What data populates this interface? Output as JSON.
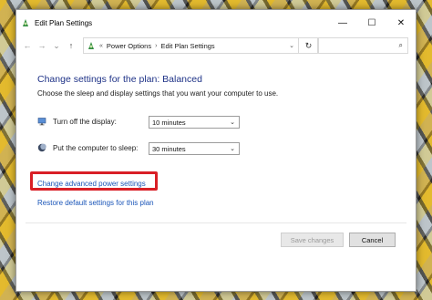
{
  "window": {
    "title": "Edit Plan Settings",
    "minimize_glyph": "—",
    "maximize_glyph": "☐",
    "close_glyph": "✕"
  },
  "nav": {
    "back_glyph": "←",
    "forward_glyph": "→",
    "dropdown_glyph": "⌄",
    "up_glyph": "↑",
    "overflow_glyph": "«",
    "breadcrumb": [
      "Power Options",
      "Edit Plan Settings"
    ],
    "separator_glyph": "›",
    "refresh_glyph": "↻",
    "search_placeholder": "",
    "search_glyph": "⌕"
  },
  "main": {
    "heading": "Change settings for the plan: Balanced",
    "subheading": "Choose the sleep and display settings that you want your computer to use.",
    "settings": [
      {
        "icon": "display-icon",
        "label": "Turn off the display:",
        "value": "10 minutes"
      },
      {
        "icon": "moon-icon",
        "label": "Put the computer to sleep:",
        "value": "30 minutes"
      }
    ],
    "select_chevron": "⌄",
    "advanced_link": "Change advanced power settings",
    "restore_link": "Restore default settings for this plan"
  },
  "buttons": {
    "save": "Save changes",
    "cancel": "Cancel"
  },
  "colors": {
    "heading": "#1e3287",
    "link": "#1a55b8",
    "highlight": "#d91f26"
  }
}
